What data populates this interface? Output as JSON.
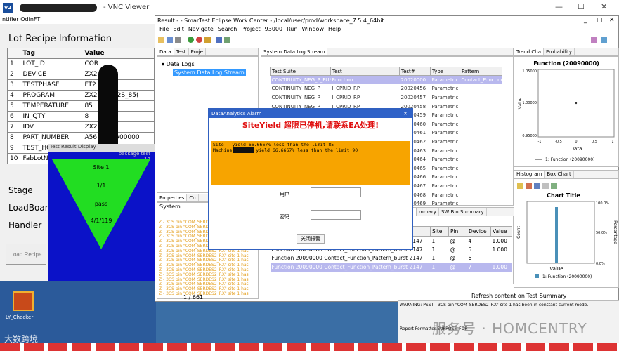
{
  "vnc": {
    "title": "- VNC Viewer",
    "icon": "V2"
  },
  "desktop": {
    "icon_label": "LY_Checker",
    "watermark": "大数跨境"
  },
  "lot_window": {
    "title": "ntifier OdinFT",
    "heading": "Lot Recipe Information",
    "columns": [
      "",
      "Tag",
      "Value"
    ],
    "rows": [
      {
        "n": "1",
        "tag": "LOT_ID",
        "value": "COR"
      },
      {
        "n": "2",
        "tag": "DEVICE",
        "value": "ZX2  A"
      },
      {
        "n": "3",
        "tag": "TESTPHASE",
        "value": "FT2"
      },
      {
        "n": "4",
        "tag": "PROGRAM",
        "value": "ZX2  _FT2_2S_85("
      },
      {
        "n": "5",
        "tag": "TEMPERATURE",
        "value": "85"
      },
      {
        "n": "6",
        "tag": "IN_QTY",
        "value": "8"
      },
      {
        "n": "7",
        "tag": "IDV",
        "value": "ZX2  A"
      },
      {
        "n": "8",
        "tag": "PART_NUMBER",
        "value": "A56  1412A00000"
      },
      {
        "n": "9",
        "tag": "TEST_HOUSE_ID",
        "value": "HT"
      },
      {
        "n": "10",
        "tag": "FabLotNo",
        "value": ""
      }
    ],
    "labels": {
      "stage": "Stage",
      "loadboard": "LoadBoar",
      "handler": "Handler"
    },
    "load_button": "Load Recipe"
  },
  "test_result": {
    "title": "Test Result Display",
    "package": "package test",
    "package_num": "12",
    "site": "Site 1",
    "count": "1/1",
    "status": "pass",
    "date": "4/1/119"
  },
  "eclipse": {
    "title": "Result - - SmarTest Eclipse Work Center - /local/user/prod/workspace_7.5.4_64bit",
    "menu": [
      "File",
      "Edit",
      "Navigate",
      "Search",
      "Project",
      "93000",
      "Run",
      "Window",
      "Help"
    ],
    "left_tabs": [
      "Data",
      "Test",
      "Proje"
    ],
    "tree": {
      "root": "Data Logs",
      "child": "System Data Log Stream"
    },
    "log_tab": "System Data Log Stream",
    "log_columns": [
      "Test Suite",
      "Test",
      "Test#",
      "Type",
      "Pattern"
    ],
    "log_rows": [
      {
        "suite": "CONTINUITY_NEG_P_FUN",
        "test": "Function",
        "num": "20020000",
        "type": "Parametric",
        "pattern": "Contact_Function"
      },
      {
        "suite": "CONTINUITY_NEG_P",
        "test": "I_CPRID_RP",
        "num": "20020456",
        "type": "Parametric",
        "pattern": ""
      },
      {
        "suite": "CONTINUITY_NEG_P",
        "test": "I_CPRID_RP",
        "num": "20020457",
        "type": "Parametric",
        "pattern": ""
      },
      {
        "suite": "CONTINUITY_NEG_P",
        "test": "I_CPRID_RP",
        "num": "20020458",
        "type": "Parametric",
        "pattern": ""
      },
      {
        "suite": "",
        "test": "",
        "num": "20020459",
        "type": "Parametric",
        "pattern": ""
      },
      {
        "suite": "",
        "test": "",
        "num": "20020460",
        "type": "Parametric",
        "pattern": ""
      },
      {
        "suite": "",
        "test": "",
        "num": "20020461",
        "type": "Parametric",
        "pattern": ""
      },
      {
        "suite": "",
        "test": "",
        "num": "20020462",
        "type": "Parametric",
        "pattern": ""
      },
      {
        "suite": "",
        "test": "",
        "num": "20020463",
        "type": "Parametric",
        "pattern": ""
      },
      {
        "suite": "",
        "test": "",
        "num": "20020464",
        "type": "Parametric",
        "pattern": ""
      },
      {
        "suite": "",
        "test": "",
        "num": "20020465",
        "type": "Parametric",
        "pattern": ""
      },
      {
        "suite": "",
        "test": "",
        "num": "20020466",
        "type": "Parametric",
        "pattern": ""
      },
      {
        "suite": "",
        "test": "",
        "num": "20020467",
        "type": "Parametric",
        "pattern": ""
      },
      {
        "suite": "",
        "test": "",
        "num": "20020468",
        "type": "Parametric",
        "pattern": ""
      },
      {
        "suite": "",
        "test": "",
        "num": "20020469",
        "type": "Parametric",
        "pattern": ""
      }
    ],
    "sys_tabs": [
      "Properties",
      "Co"
    ],
    "sys_label": "System",
    "sys_lines": [
      "Z - 3CS pin \"COM_SERDES2_RX\" site 1 has",
      "Z - 3CS pin \"COM_SERDES2_RX\" site 1 has",
      "Z - 3CS pin \"COM_SERDES2_RX\" site 1 has",
      "Z - 3CS pin \"COM_SERDES2_RX\" site 1 has",
      "Z - 3CS pin \"COM_SERDES2_RX\" site 1 has",
      "Z - 3CS pin \"COM_SERDES2_RX\" site 1 has",
      "Z - 3CS pin \"COM_SERDES2_RX\" site 1 has",
      "Z - 3CS pin \"COM_SERDES2_RX\" site 1 has",
      "Z - 3CS pin \"COM_SERDES2_RX\" site 1 has",
      "Z - 3CS pin \"COM_SERDES2_RX\" site 1 has",
      "Z - 3CS pin \"COM_SERDES2_RX\" site 1 has",
      "Z - 3CS pin \"COM_SERDES2_RX\" site 1 has",
      "Z - 3CS pin \"COM_SERDES2_RX\" site 1 has",
      "Z - 3CS pin \"COM_SERDES2_RX\" site 1 has",
      "Z - 3CS pin \"COM_SERDES2_RX\" site 1 has",
      "Z - 3CS pin \"COM_SERDES2_RX\" site 1 has"
    ],
    "status_left": "1 / 661",
    "summary_tabs": [
      "mmary",
      "SW Bin Summary"
    ],
    "sum_columns": [
      "afer",
      "Site",
      "Pin",
      "Device",
      "Value"
    ],
    "sum_rows": [
      {
        "a": "Function 20090000 Contact_Function_Pattern_burst 2147",
        "site": "1",
        "pin": "@",
        "dev": "4",
        "val": "1.000"
      },
      {
        "a": "Function 20090000 Contact_Function_Pattern_burst 2147",
        "site": "1",
        "pin": "@",
        "dev": "5",
        "val": "1.000"
      },
      {
        "a": "Function 20090000 Contact_Function_Pattern_burst 2147",
        "site": "1",
        "pin": "@",
        "dev": "6",
        "val": ""
      },
      {
        "a": "Function 20090000 Contact_Function_Pattern_burst 2147",
        "site": "1",
        "pin": "@",
        "dev": "7",
        "val": "1.000"
      }
    ],
    "status_right": "Refresh content on Test Summary",
    "right_tabs": [
      "Trend Cha",
      "Probability"
    ],
    "hist_tabs": [
      "Histogram",
      "Box Chart"
    ]
  },
  "func_chart": {
    "title": "Function (20090000)",
    "ylabel": "Value",
    "xlabel": "Data",
    "legend": "1: Function (20090000)",
    "yticks": [
      "1.05000",
      "1.00000",
      "0.95000"
    ],
    "xticks": [
      "-1",
      "-0.5",
      "0",
      "0.5",
      "1"
    ]
  },
  "hist_chart": {
    "title": "Chart Title",
    "ylabel": "Count",
    "ylabel2": "Percentage",
    "xlabel": "Value",
    "legend": "1: Function (20090000)",
    "pct_ticks": [
      "100.0%",
      "50.0%",
      "0.0%"
    ]
  },
  "alarm": {
    "title": "DataAnalytics Alarm",
    "heading": "SiteYield 超限已停机,请联系EA处理!",
    "line1": "Site : yield 66.6667% less than the limit 85",
    "line2_prefix": "Machine",
    "line2_suffix": "yield 66.6667% less than the limit 90",
    "user_label": "用户",
    "pwd_label": "密码",
    "button": "关闭报警"
  },
  "warn": {
    "text": "WARNING: PSST - 3CS pin \"COM_SERDES2_RX\" site 1 has been in constant current mode.",
    "footer": "Report Formatter    SUPPOSE_FOR_"
  },
  "watermark_right": "服务号 · HOMCENTRY",
  "colors": {
    "pass": "#22dd22",
    "trd_bg": "#0b12c8",
    "alarm_box": "#f7a400",
    "alarm_head": "#e01010"
  }
}
